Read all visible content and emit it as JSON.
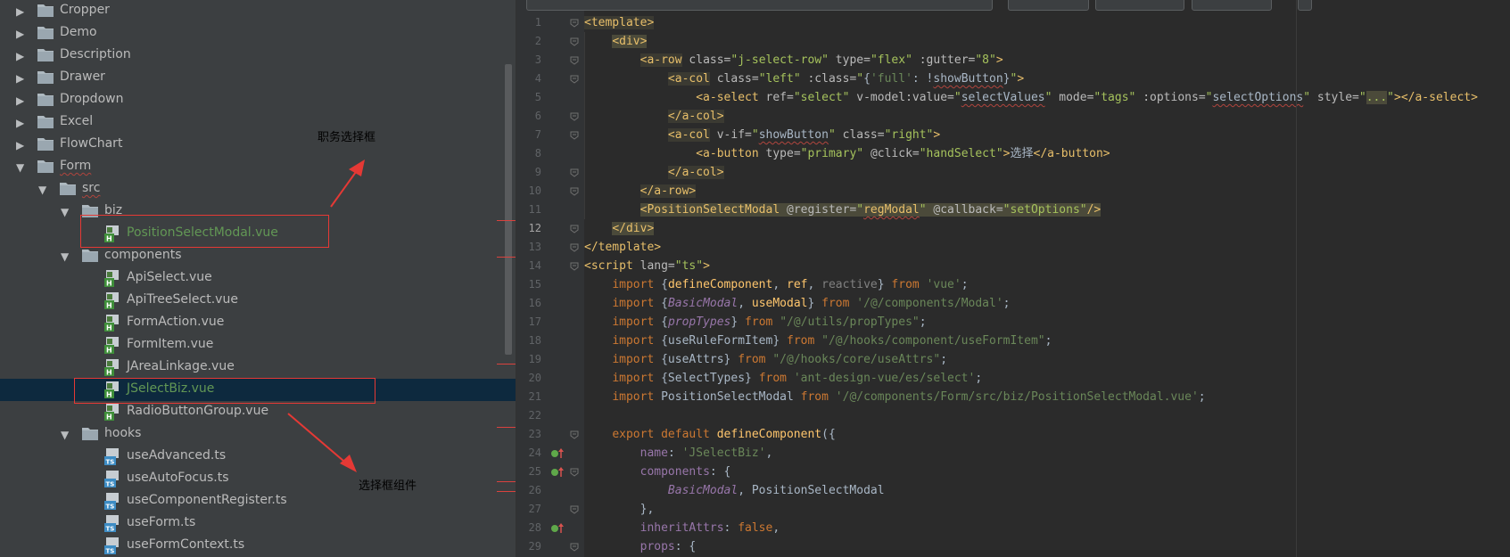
{
  "tree": {
    "items": [
      {
        "label": "Cropper",
        "kind": "folder",
        "depth": 0,
        "open": false
      },
      {
        "label": "Demo",
        "kind": "folder",
        "depth": 0,
        "open": false
      },
      {
        "label": "Description",
        "kind": "folder",
        "depth": 0,
        "open": false
      },
      {
        "label": "Drawer",
        "kind": "folder",
        "depth": 0,
        "open": false
      },
      {
        "label": "Dropdown",
        "kind": "folder",
        "depth": 0,
        "open": false
      },
      {
        "label": "Excel",
        "kind": "folder",
        "depth": 0,
        "open": false
      },
      {
        "label": "FlowChart",
        "kind": "folder",
        "depth": 0,
        "open": false
      },
      {
        "label": "Form",
        "kind": "folder",
        "depth": 0,
        "open": true,
        "wavy": true
      },
      {
        "label": "src",
        "kind": "folder",
        "depth": 1,
        "open": true,
        "wavy": true
      },
      {
        "label": "biz",
        "kind": "folder",
        "depth": 2,
        "open": true
      },
      {
        "label": "PositionSelectModal.vue",
        "kind": "vue",
        "depth": 3,
        "color": "green"
      },
      {
        "label": "components",
        "kind": "folder",
        "depth": 2,
        "open": true
      },
      {
        "label": "ApiSelect.vue",
        "kind": "vue",
        "depth": 3
      },
      {
        "label": "ApiTreeSelect.vue",
        "kind": "vue",
        "depth": 3
      },
      {
        "label": "FormAction.vue",
        "kind": "vue",
        "depth": 3
      },
      {
        "label": "FormItem.vue",
        "kind": "vue",
        "depth": 3
      },
      {
        "label": "JAreaLinkage.vue",
        "kind": "vue",
        "depth": 3
      },
      {
        "label": "JSelectBiz.vue",
        "kind": "vue",
        "depth": 3,
        "color": "green",
        "selected": true
      },
      {
        "label": "RadioButtonGroup.vue",
        "kind": "vue",
        "depth": 3
      },
      {
        "label": "hooks",
        "kind": "folder",
        "depth": 2,
        "open": true
      },
      {
        "label": "useAdvanced.ts",
        "kind": "ts",
        "depth": 3
      },
      {
        "label": "useAutoFocus.ts",
        "kind": "ts",
        "depth": 3
      },
      {
        "label": "useComponentRegister.ts",
        "kind": "ts",
        "depth": 3
      },
      {
        "label": "useForm.ts",
        "kind": "ts",
        "depth": 3
      },
      {
        "label": "useFormContext.ts",
        "kind": "ts",
        "depth": 3
      }
    ]
  },
  "annotations": {
    "label1": "职务选择框",
    "label2": "选择框组件",
    "color": "#e53935"
  },
  "editor": {
    "current_line": 12,
    "lines": [
      {
        "n": 1,
        "code": "<span class='t-tag t-hl'>&lt;template&gt;</span>"
      },
      {
        "n": 2,
        "code": "    <span class='t-tag t-hl2'>&lt;div&gt;</span>"
      },
      {
        "n": 3,
        "code": "        <span class='t-tag t-hl'>&lt;a-row</span> <span class='t-attr'>class=</span><span class='t-val'>\"j-select-row\"</span> <span class='t-attr'>type=</span><span class='t-val'>\"flex\"</span> <span class='t-attr'>:gutter=</span><span class='t-val'>\"8\"</span><span class='t-tag'>&gt;</span>"
      },
      {
        "n": 4,
        "code": "            <span class='t-tag t-hl'>&lt;a-col</span> <span class='t-attr'>class=</span><span class='t-val'>\"left\"</span> <span class='t-attr'>:class=</span><span class='t-val'>\"</span>{<span class='t-str'>'full'</span>: !<span class='wavy'>showButton</span>}<span class='t-val'>\"</span><span class='t-tag'>&gt;</span>"
      },
      {
        "n": 5,
        "code": "                <span class='t-tag'>&lt;a-select</span> <span class='t-attr'>ref=</span><span class='t-val'>\"select\"</span> <span class='t-attr'>v-model:value=</span><span class='t-val'>\"</span><span class='wavy'>selectValues</span><span class='t-val'>\"</span> <span class='t-attr'>mode=</span><span class='t-val'>\"tags\"</span> <span class='t-attr'>:options=</span><span class='t-val'>\"</span><span class='wavy'>selectOptions</span><span class='t-val'>\"</span> <span class='t-attr'>style=</span><span class='t-val'>\"<span class='t-hl2'>...</span>\"</span><span class='t-tag'>&gt;&lt;/a-select&gt;</span>"
      },
      {
        "n": 6,
        "code": "            <span class='t-tag t-hl'>&lt;/a-col&gt;</span>"
      },
      {
        "n": 7,
        "code": "            <span class='t-tag t-hl'>&lt;a-col</span> <span class='t-attr'>v-if=</span><span class='t-val'>\"</span><span class='wavy'>showButton</span><span class='t-val'>\"</span> <span class='t-attr'>class=</span><span class='t-val'>\"right\"</span><span class='t-tag'>&gt;</span>"
      },
      {
        "n": 8,
        "code": "                <span class='t-tag'>&lt;a-button</span> <span class='t-attr'>type=</span><span class='t-val'>\"primary\"</span> <span class='t-attr'>@click=</span><span class='t-val'>\"handSelect\"</span><span class='t-tag'>&gt;</span>选择<span class='t-tag'>&lt;/a-button&gt;</span>"
      },
      {
        "n": 9,
        "code": "            <span class='t-tag t-hl'>&lt;/a-col&gt;</span>"
      },
      {
        "n": 10,
        "code": "        <span class='t-tag t-hl'>&lt;/a-row&gt;</span>"
      },
      {
        "n": 11,
        "code": "        <span class='t-tag t-hl2'>&lt;PositionSelectModal <span class='t-attr'>@register=</span><span class='t-val'>\"</span><span class='wavy'>regModal</span><span class='t-val'>\"</span> <span class='t-attr'>@callback=</span><span class='t-val'>\"setOptions\"</span>/&gt;</span>"
      },
      {
        "n": 12,
        "code": "    <span class='t-tag t-hl2'>&lt;/div&gt;</span>"
      },
      {
        "n": 13,
        "code": "<span class='t-tag'>&lt;/template&gt;</span>"
      },
      {
        "n": 14,
        "code": "<span class='t-tag'>&lt;script</span> <span class='t-attr'>lang=</span><span class='t-val'>\"ts\"</span><span class='t-tag'>&gt;</span>"
      },
      {
        "n": 15,
        "code": "    <span class='t-kw'>import</span> {<span class='t-fn'>defineComponent</span>, <span class='t-fn'>ref</span>, <span class='t-grey'>reactive</span>} <span class='t-kw'>from</span> <span class='t-str'>'vue'</span>;"
      },
      {
        "n": 16,
        "code": "    <span class='t-kw'>import</span> {<span class='t-it'>BasicModal</span>, <span class='t-fn'>useModal</span>} <span class='t-kw'>from</span> <span class='t-str'>'/@/components/Modal'</span>;"
      },
      {
        "n": 17,
        "code": "    <span class='t-kw'>import</span> {<span class='t-it'>propTypes</span>} <span class='t-kw'>from</span> <span class='t-str'>\"/@/utils/propTypes\"</span>;"
      },
      {
        "n": 18,
        "code": "    <span class='t-kw'>import</span> {useRuleFormItem} <span class='t-kw'>from</span> <span class='t-str'>\"/@/hooks/component/useFormItem\"</span>;"
      },
      {
        "n": 19,
        "code": "    <span class='t-kw'>import</span> {useAttrs} <span class='t-kw'>from</span> <span class='t-str'>\"/@/hooks/core/useAttrs\"</span>;"
      },
      {
        "n": 20,
        "code": "    <span class='t-kw'>import</span> {SelectTypes} <span class='t-kw'>from</span> <span class='t-str'>'ant-design-vue/es/select'</span>;"
      },
      {
        "n": 21,
        "code": "    <span class='t-kw'>import</span> PositionSelectModal <span class='t-kw'>from</span> <span class='t-str'>'/@/components/Form/src/biz/PositionSelectModal.vue'</span>;"
      },
      {
        "n": 22,
        "code": ""
      },
      {
        "n": 23,
        "code": "    <span class='t-kw'>export default</span> <span class='t-fn'>defineComponent</span>({"
      },
      {
        "n": 24,
        "code": "        <span class='t-prop'>name</span>: <span class='t-str'>'JSelectBiz'</span>,"
      },
      {
        "n": 25,
        "code": "        <span class='t-prop'>components</span>: {"
      },
      {
        "n": 26,
        "code": "            <span class='t-it'>BasicModal</span>, PositionSelectModal"
      },
      {
        "n": 27,
        "code": "        },"
      },
      {
        "n": 28,
        "code": "        <span class='t-prop'>inheritAttrs</span>: <span class='t-kw'>false</span>,"
      },
      {
        "n": 29,
        "code": "        <span class='t-prop'>props</span>: {"
      }
    ]
  }
}
